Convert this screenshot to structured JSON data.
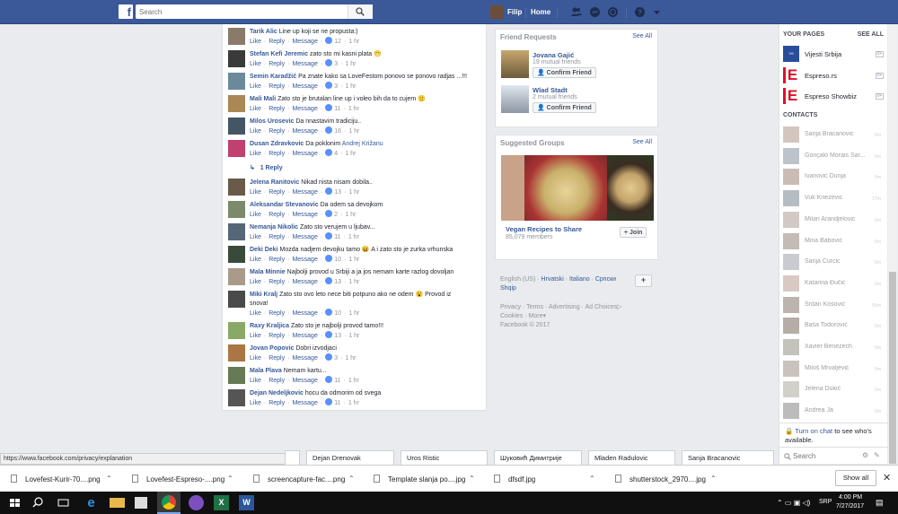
{
  "topbar": {
    "search_placeholder": "Search",
    "user_name": "Filip",
    "home_label": "Home"
  },
  "comments": [
    {
      "name": "Tarik Alic",
      "text": "Line up koji se ne propusta:)",
      "likes": "12",
      "time": "1 hr"
    },
    {
      "name": "Stefan Kefi Jeremic",
      "text": "zato sto mi kasni plata 😁",
      "likes": "3",
      "time": "1 hr"
    },
    {
      "name": "Semin Karadžić",
      "text": "Pa znate kako sa LoveFestom ponovo se ponovo radjas ...!!!",
      "likes": "3",
      "time": "1 hr"
    },
    {
      "name": "Mali Mali",
      "text": "Zato sto je brutalan line up i voleo bih da to cujem 🙂",
      "likes": "11",
      "time": "1 hr"
    },
    {
      "name": "Milos Urosevic",
      "text": "Da nnastavim tradiciju..",
      "likes": "16",
      "time": "1 hr"
    },
    {
      "name": "Dusan Zdravkovic",
      "text": "Da poklonim",
      "mention": "Andrej Križanu",
      "likes": "4",
      "time": "1 hr"
    },
    {
      "name": "Jelena Ranitovic",
      "text": "Nikad nista nisam dobila..",
      "likes": "13",
      "time": "1 hr"
    },
    {
      "name": "Aleksandar Stevanovic",
      "text": "Da odem sa devojkom",
      "likes": "2",
      "time": "1 hr"
    },
    {
      "name": "Nemanja Nikolic",
      "text": "Zato sto verujem u ljubav...",
      "likes": "11",
      "time": "1 hr"
    },
    {
      "name": "Deki Deki",
      "text": "Mozda nadjem devojku tamo 😆 A i zato sto je zurka vrhunska",
      "likes": "10",
      "time": "1 hr"
    },
    {
      "name": "Mala Minnie",
      "text": "Najbolji provod u Srbiji a ja jos nemam karte razlog dovoljan",
      "likes": "13",
      "time": "1 hr"
    },
    {
      "name": "Miki Kralj",
      "text": "Zato sto ovo leto nece biti potpuno ako ne odem 😮 Provod iz",
      "text2": "snova!",
      "likes": "10",
      "time": "1 hr"
    },
    {
      "name": "Raxy Kraljica",
      "text": "Zato sto je najbolji provod tamo!!!",
      "likes": "13",
      "time": "1 hr"
    },
    {
      "name": "Jovan Popovic",
      "text": "Dobri izvodjaci",
      "likes": "3",
      "time": "1 hr"
    },
    {
      "name": "Mala Plava",
      "text": "Nemam kartu...",
      "likes": "11",
      "time": "1 hr"
    },
    {
      "name": "Dejan Nedeljkovic",
      "text": "hocu da odmorim od svega",
      "likes": "11",
      "time": "1 hr"
    }
  ],
  "comment_actions": {
    "like": "Like",
    "reply": "Reply",
    "message": "Message",
    "dot": "·"
  },
  "reply_count": "1 Reply",
  "friend_requests": {
    "title": "Friend Requests",
    "see_all": "See All",
    "items": [
      {
        "name": "Jovana Gajić",
        "mutual": "19 mutual friends",
        "button": "Confirm Friend"
      },
      {
        "name": "Wlad Stadt",
        "mutual": "2 mutual friends",
        "button": "Confirm Friend"
      }
    ]
  },
  "suggested_groups": {
    "title": "Suggested Groups",
    "see_all": "See All",
    "group_name": "Vegan Recipes to Share",
    "members": "85,079 members",
    "join": "+ Join"
  },
  "languages": {
    "items": [
      "English (US)",
      "Hrvatski",
      "Italiano",
      "Српски"
    ],
    "second_line": "Shqip",
    "add": "+"
  },
  "footer": {
    "line1": [
      "Privacy",
      "Terms",
      "Advertising",
      "Ad Choices"
    ],
    "line2": [
      "Cookies",
      "More"
    ],
    "copyright": "Facebook © 2017"
  },
  "right_col": {
    "your_pages": "YOUR PAGES",
    "see_all": "SEE ALL",
    "pages": [
      {
        "name": "Vijesti Srbija",
        "badge": "0+"
      },
      {
        "name": "Espreso.rs",
        "badge": "0+"
      },
      {
        "name": "Espreso Showbiz",
        "badge": "0+"
      }
    ],
    "contacts_title": "CONTACTS",
    "contacts": [
      {
        "name": "Sanja Bracanovic",
        "time": "5m"
      },
      {
        "name": "Gonçalo Morais Sar...",
        "time": "5m"
      },
      {
        "name": "Ivanovic Dunja",
        "time": "5m"
      },
      {
        "name": "Vuk Knezevic",
        "time": "17m"
      },
      {
        "name": "Milan Arandjelovic",
        "time": "5m"
      },
      {
        "name": "Mina Babović",
        "time": "5m"
      },
      {
        "name": "Sanja Curcic",
        "time": "5m"
      },
      {
        "name": "Katarina Đučić",
        "time": "2m"
      },
      {
        "name": "Srdan Kosović",
        "time": "55m"
      },
      {
        "name": "Baša Todorović",
        "time": "5m"
      },
      {
        "name": "Xavier Bénézech",
        "time": "5m"
      },
      {
        "name": "Miloš Mrvaljević",
        "time": "5m"
      },
      {
        "name": "Jelena Dukić",
        "time": "5m"
      },
      {
        "name": "Andrea Ja",
        "time": "5m"
      }
    ],
    "turn_on_chat": "Turn on chat",
    "turn_on_chat_rest": "to see who's available.",
    "search_placeholder": "Search"
  },
  "chat_tabs": [
    "Dejan Drenovak",
    "Uros Ristic",
    "Шуковић Димитрије",
    "Mladen Radulovic",
    "Sanja Bracanovic"
  ],
  "status_url": "https://www.facebook.com/privacy/explanation",
  "downloads": [
    "Lovefest-Kurir-70....png",
    "Lovefest-Espreso-....png",
    "screencapture-fac....png",
    "Template slanja po....jpg",
    "dfsdf.jpg",
    "shutterstock_2970....jpg"
  ],
  "show_all": "Show all",
  "taskbar": {
    "lang": "SRP",
    "time": "4:00 PM",
    "date": "7/27/2017"
  },
  "colors": {
    "fb_blue": "#3b5998",
    "link": "#365899",
    "like": "#5890ff"
  }
}
